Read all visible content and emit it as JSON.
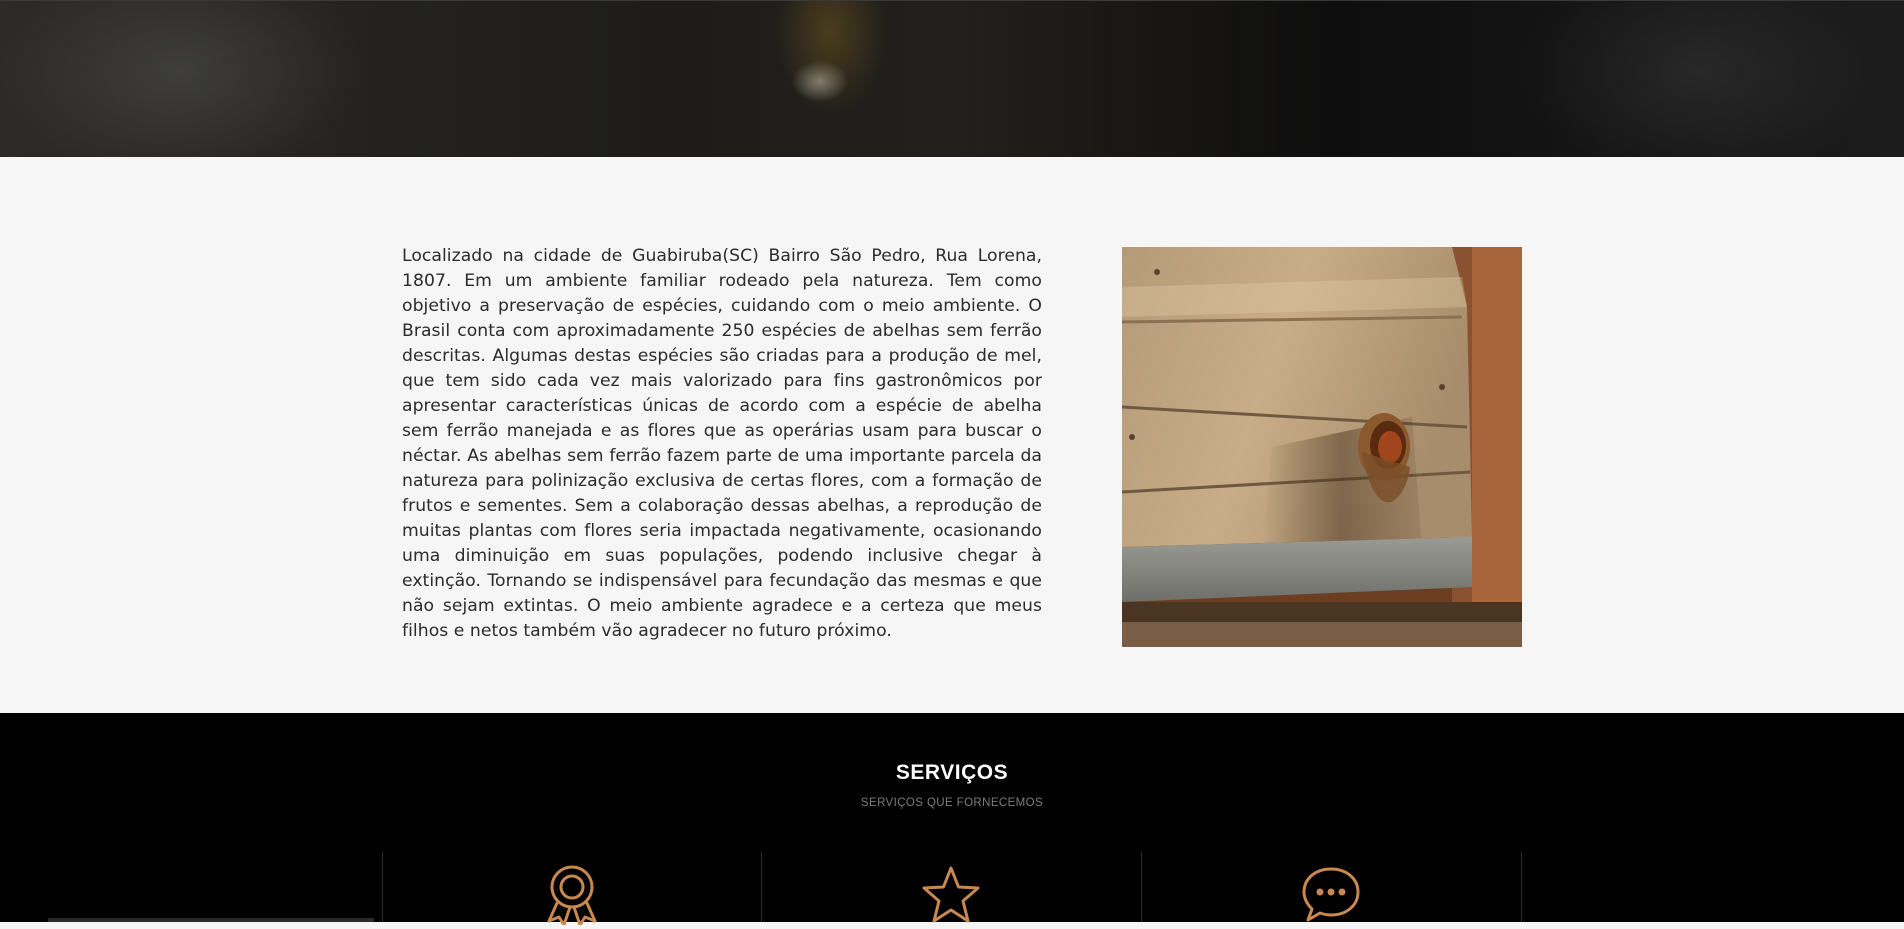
{
  "hero": {
    "image_name": "bee-closeup-banner"
  },
  "about": {
    "paragraph": "Localizado na cidade de Guabiruba(SC) Bairro São Pedro, Rua Lorena, 1807. Em um ambiente familiar rodeado pela natureza. Tem como objetivo a preservação de espécies, cuidando com o meio ambiente. O Brasil conta com aproximadamente 250 espécies de abelhas sem ferrão descritas. Algumas destas espécies são criadas para a produção de mel, que tem sido cada vez mais valorizado para fins gastronômicos por apresentar características únicas de acordo com a espécie de abelha sem ferrão manejada e as flores que as operárias usam para buscar o néctar. As abelhas sem ferrão fazem parte de uma importante parcela da natureza para polinização exclusiva de certas flores, com a formação de frutos e sementes. Sem a colaboração dessas abelhas, a reprodução de muitas plantas com flores seria impactada negativamente, ocasionando uma diminuição em suas populações, podendo inclusive chegar à extinção. Tornando se indispensável para fecundação das mesmas e que não sejam extintas. O meio ambiente agradece e a certeza que meus filhos e netos também vão agradecer no futuro próximo.",
    "photo_name": "wooden-beehive-entrance-photo"
  },
  "services": {
    "title": "SERVIÇOS",
    "subtitle": "SERVIÇOS QUE FORNECEMOS",
    "items": [
      {
        "icon": "award-ribbon-icon"
      },
      {
        "icon": "star-icon"
      },
      {
        "icon": "chat-bubble-icon"
      }
    ]
  },
  "colors": {
    "accent": "#c8884e",
    "services_bg": "#000000",
    "about_bg": "#f6f6f6",
    "text": "#2b2b2b"
  }
}
